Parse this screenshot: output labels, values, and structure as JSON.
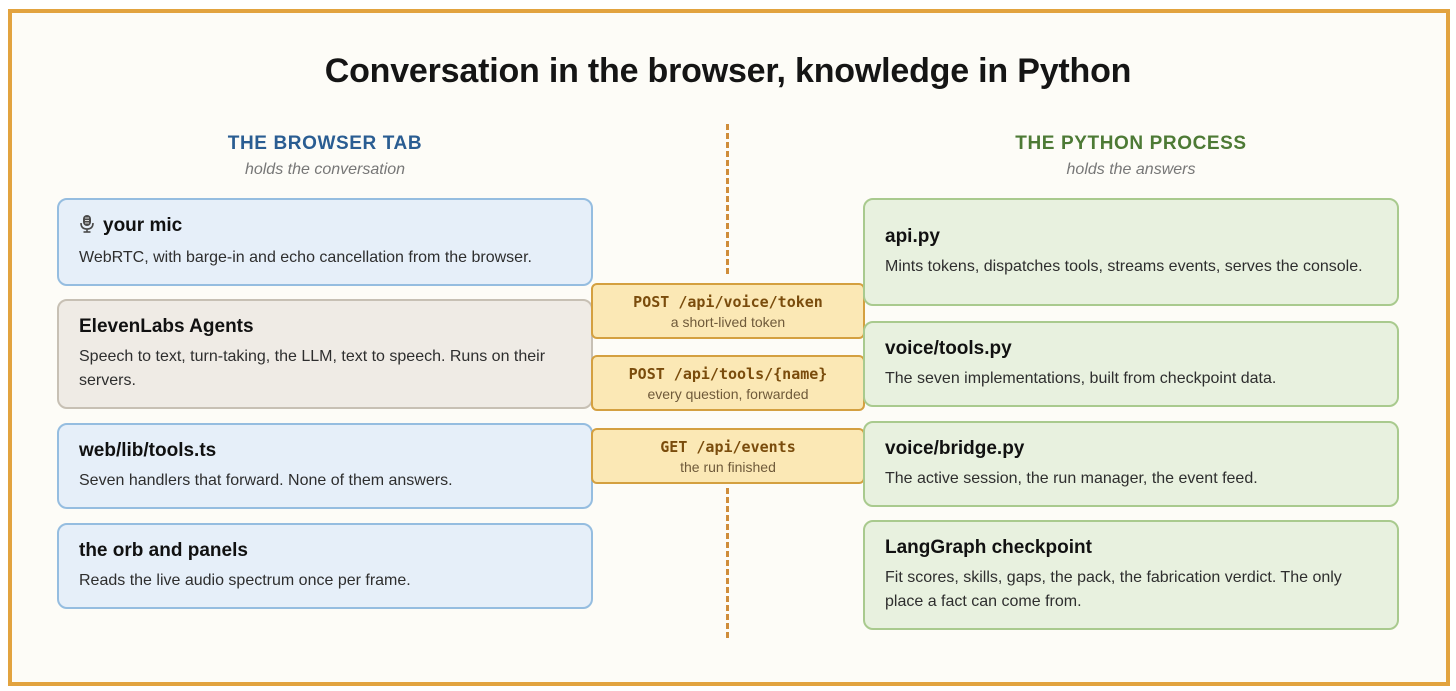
{
  "title": "Conversation in the browser, knowledge in Python",
  "left": {
    "heading": "THE BROWSER TAB",
    "subheading": "holds the conversation",
    "items": [
      {
        "title": "your mic",
        "icon": "microphone-icon",
        "desc": "WebRTC, with barge-in and echo cancellation from the browser."
      },
      {
        "title": "ElevenLabs Agents",
        "desc": "Speech to text, turn-taking, the LLM, text to speech. Runs on their servers."
      },
      {
        "title": "web/lib/tools.ts",
        "desc": "Seven handlers that forward. None of them answers."
      },
      {
        "title": "the orb and panels",
        "desc": "Reads the live audio spectrum once per frame."
      }
    ]
  },
  "right": {
    "heading": "THE PYTHON PROCESS",
    "subheading": "holds the answers",
    "items": [
      {
        "title": "api.py",
        "desc": "Mints tokens, dispatches tools, streams events, serves the console."
      },
      {
        "title": "voice/tools.py",
        "desc": "The seven implementations, built from checkpoint data."
      },
      {
        "title": "voice/bridge.py",
        "desc": "The active session, the run manager, the event feed."
      },
      {
        "title": "LangGraph checkpoint",
        "desc": "Fit scores, skills, gaps, the pack, the fabrication verdict. The only place a fact can come from."
      }
    ]
  },
  "endpoints": [
    {
      "route": "POST /api/voice/token",
      "note": "a short-lived token"
    },
    {
      "route": "POST /api/tools/{name}",
      "note": "every question, forwarded"
    },
    {
      "route": "GET /api/events",
      "note": "the run finished"
    }
  ],
  "colors": {
    "frame": "#e2a33f",
    "browser_heading": "#2a5d92",
    "python_heading": "#4d7a35",
    "endpoint_fill": "#fbe8b5"
  }
}
